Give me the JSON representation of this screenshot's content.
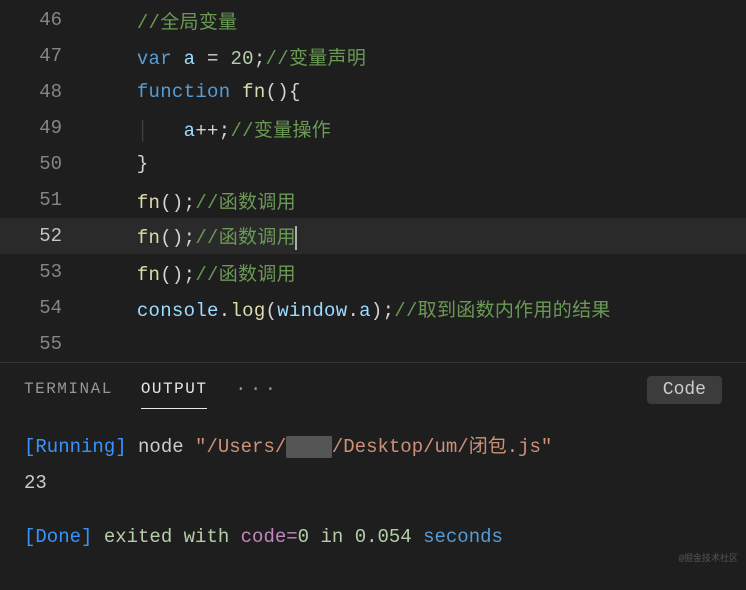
{
  "editor": {
    "lines": [
      {
        "num": "46",
        "active": false,
        "tokens": [
          {
            "cls": "punctuation",
            "t": "    "
          },
          {
            "cls": "comment",
            "t": "//全局变量"
          }
        ]
      },
      {
        "num": "47",
        "active": false,
        "tokens": [
          {
            "cls": "punctuation",
            "t": "    "
          },
          {
            "cls": "keyword",
            "t": "var"
          },
          {
            "cls": "punctuation",
            "t": " "
          },
          {
            "cls": "variable",
            "t": "a"
          },
          {
            "cls": "punctuation",
            "t": " = "
          },
          {
            "cls": "number",
            "t": "20"
          },
          {
            "cls": "punctuation",
            "t": ";"
          },
          {
            "cls": "comment",
            "t": "//变量声明"
          }
        ]
      },
      {
        "num": "48",
        "active": false,
        "tokens": [
          {
            "cls": "punctuation",
            "t": "    "
          },
          {
            "cls": "keyword",
            "t": "function"
          },
          {
            "cls": "punctuation",
            "t": " "
          },
          {
            "cls": "function-name",
            "t": "fn"
          },
          {
            "cls": "punctuation",
            "t": "(){"
          }
        ]
      },
      {
        "num": "49",
        "active": false,
        "tokens": [
          {
            "cls": "punctuation",
            "t": "    "
          },
          {
            "cls": "indent-guide",
            "t": "│   "
          },
          {
            "cls": "variable",
            "t": "a"
          },
          {
            "cls": "punctuation",
            "t": "++;"
          },
          {
            "cls": "comment",
            "t": "//变量操作"
          }
        ]
      },
      {
        "num": "50",
        "active": false,
        "tokens": [
          {
            "cls": "punctuation",
            "t": "    }"
          }
        ]
      },
      {
        "num": "51",
        "active": false,
        "tokens": [
          {
            "cls": "punctuation",
            "t": "    "
          },
          {
            "cls": "function-name",
            "t": "fn"
          },
          {
            "cls": "punctuation",
            "t": "();"
          },
          {
            "cls": "comment",
            "t": "//函数调用"
          }
        ]
      },
      {
        "num": "52",
        "active": true,
        "cursor": true,
        "tokens": [
          {
            "cls": "punctuation",
            "t": "    "
          },
          {
            "cls": "function-name",
            "t": "fn"
          },
          {
            "cls": "punctuation",
            "t": "();"
          },
          {
            "cls": "comment",
            "t": "//函数调用"
          }
        ]
      },
      {
        "num": "53",
        "active": false,
        "tokens": [
          {
            "cls": "punctuation",
            "t": "    "
          },
          {
            "cls": "function-name",
            "t": "fn"
          },
          {
            "cls": "punctuation",
            "t": "();"
          },
          {
            "cls": "comment",
            "t": "//函数调用"
          }
        ]
      },
      {
        "num": "54",
        "active": false,
        "tokens": [
          {
            "cls": "punctuation",
            "t": "    "
          },
          {
            "cls": "object",
            "t": "console"
          },
          {
            "cls": "punctuation",
            "t": "."
          },
          {
            "cls": "function-name",
            "t": "log"
          },
          {
            "cls": "punctuation",
            "t": "("
          },
          {
            "cls": "object",
            "t": "window"
          },
          {
            "cls": "punctuation",
            "t": "."
          },
          {
            "cls": "variable",
            "t": "a"
          },
          {
            "cls": "punctuation",
            "t": ");"
          },
          {
            "cls": "comment",
            "t": "//取到函数内作用的结果"
          }
        ]
      },
      {
        "num": "55",
        "active": false,
        "tokens": []
      }
    ]
  },
  "panel": {
    "tabs": {
      "terminal": "TERMINAL",
      "output": "OUTPUT",
      "more": "···",
      "selector": "Code"
    },
    "output": {
      "running_label": "[Running]",
      "node": " node ",
      "path_prefix": "\"/Users/",
      "path_redacted": "████",
      "path_suffix": "/Desktop/um/闭包.js\"",
      "result": "23",
      "done_label": "[Done]",
      "exited": " exited with ",
      "code": "code=",
      "zero": "0",
      "in": " in ",
      "time": "0.054",
      "seconds": " seconds"
    }
  },
  "watermark": "@掘金技术社区"
}
